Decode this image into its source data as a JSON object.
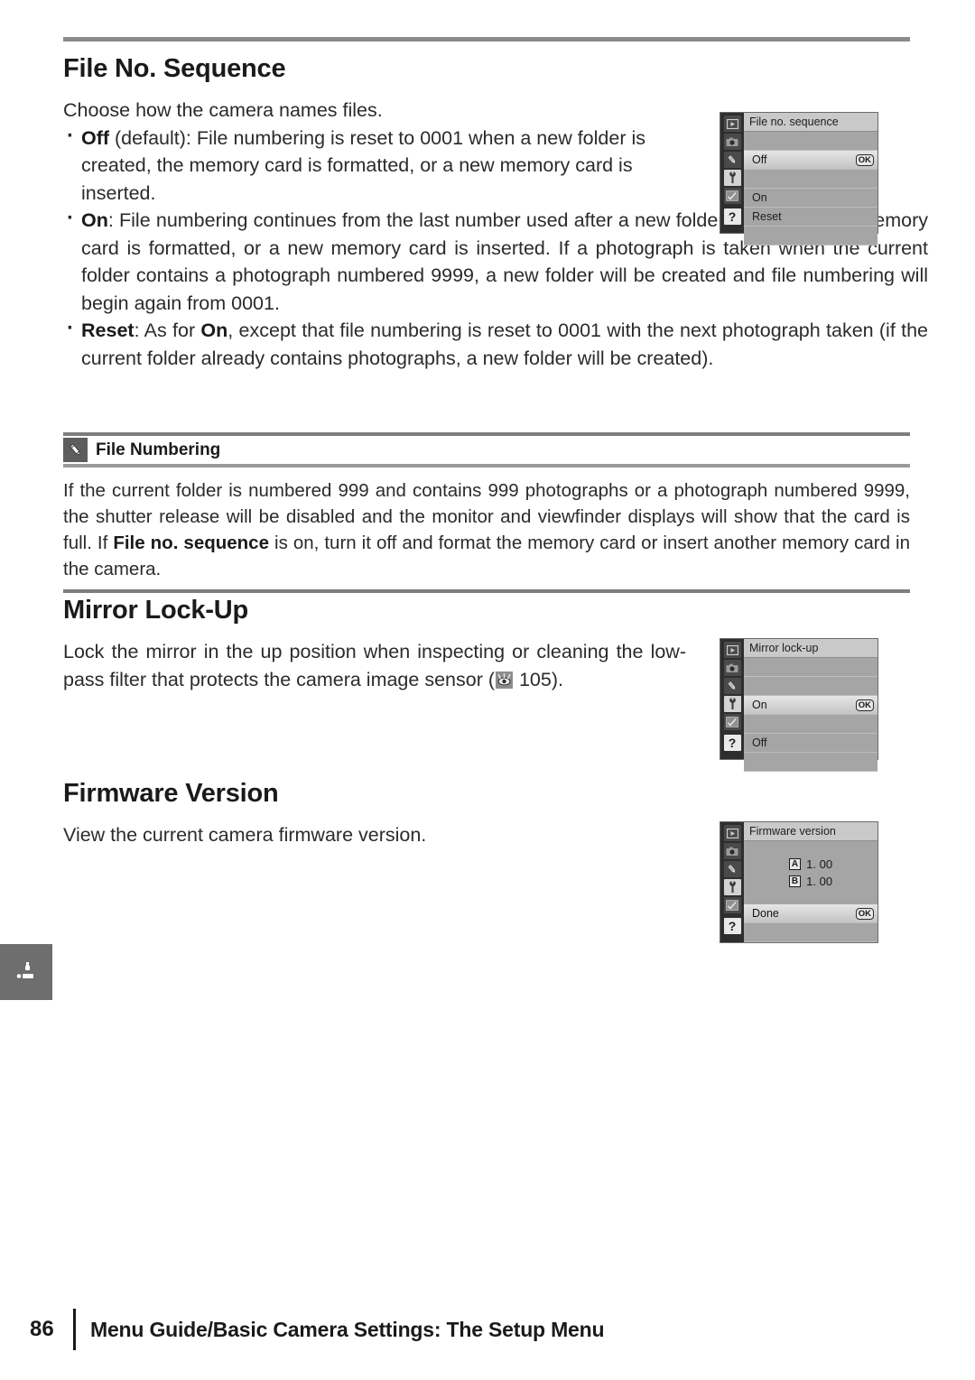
{
  "page": {
    "number": "86",
    "footer_title": "Menu Guide/Basic Camera Settings: The Setup Menu"
  },
  "sections": {
    "file_no_sequence": {
      "title": "File No. Sequence",
      "intro": "Choose how the camera names files.",
      "bullets": [
        {
          "term": "Off",
          "text": " (default): File numbering is reset to 0001 when a new folder is created, the memory card is formatted, or a new memory card is inserted."
        },
        {
          "term": "On",
          "text": ": File numbering continues from the last number used after a new folder is created, the memory card is formatted, or a new memory card is inserted.  If a photograph is taken when the current folder contains a photograph numbered 9999, a new folder will be created and file numbering will begin again from 0001."
        },
        {
          "term": "Reset",
          "text_before": ": As for ",
          "term2": "On",
          "text_after": ", except that file numbering is reset to 0001 with the next photograph taken (if the current folder already contains photographs, a new folder will be created)."
        }
      ]
    },
    "note": {
      "icon": "pencil-icon",
      "title": "File Numbering",
      "body_part1": "If the current folder is numbered 999 and contains 999 photographs or a photograph numbered 9999, the shutter release will be disabled and the monitor and viewfinder displays will show that the card is full.  If ",
      "body_bold": "File no. sequence",
      "body_part2": " is on, turn it off and format the memory card or insert another memory card in the camera."
    },
    "mirror_lock_up": {
      "title": "Mirror Lock-Up",
      "body_part1": "Lock the mirror in the up position when inspecting or cleaning the low-pass filter that protects the camera image sensor (",
      "ref_icon": "page-reference-eye-icon",
      "ref_page": " 105).",
      "body_part2": ""
    },
    "firmware_version": {
      "title": "Firmware Version",
      "body": "View the current camera firmware version."
    }
  },
  "lcd_panels": {
    "sidebar_icons": [
      "playback-icon",
      "shooting-menu-camera-icon",
      "custom-settings-pencil-icon",
      "setup-menu-wrench-icon",
      "retouch-menu-icon",
      "help-question-icon"
    ],
    "sidebar_active_index": 3,
    "help_label": "?",
    "ok_label": "OK",
    "file_no_sequence": {
      "title": "File no. sequence",
      "rows": [
        {
          "label": "",
          "selected": false,
          "ok": false
        },
        {
          "label": "Off",
          "selected": true,
          "ok": true
        },
        {
          "label": "",
          "selected": false,
          "ok": false
        },
        {
          "label": "On",
          "selected": false,
          "ok": false
        },
        {
          "label": "Reset",
          "selected": false,
          "ok": false
        },
        {
          "label": "",
          "selected": false,
          "ok": false
        }
      ]
    },
    "mirror_lock_up": {
      "title": "Mirror lock-up",
      "rows": [
        {
          "label": "",
          "selected": false,
          "ok": false
        },
        {
          "label": "",
          "selected": false,
          "ok": false
        },
        {
          "label": "On",
          "selected": true,
          "ok": true
        },
        {
          "label": "",
          "selected": false,
          "ok": false
        },
        {
          "label": "Off",
          "selected": false,
          "ok": false
        },
        {
          "label": "",
          "selected": false,
          "ok": false
        }
      ]
    },
    "firmware_version": {
      "title": "Firmware version",
      "lines": [
        {
          "badge": "A",
          "value": "1. 00"
        },
        {
          "badge": "B",
          "value": "1. 00"
        }
      ],
      "done_label": "Done",
      "ok_label": "OK"
    }
  },
  "margin_tab": {
    "icon": "setup-menu-wrench-icon"
  },
  "colors": {
    "rule": "#8b8b8b",
    "text": "#2b2b2b",
    "lcd_bg": "#a5a5a5",
    "lcd_sidebar": "#2e2e2e",
    "margin_tab": "#6e6e6e"
  }
}
